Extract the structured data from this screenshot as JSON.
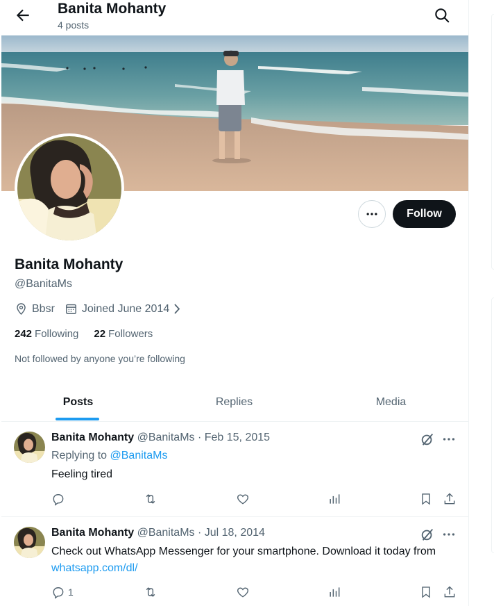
{
  "header": {
    "name": "Banita Mohanty",
    "posts_count": "4 posts"
  },
  "profile": {
    "name": "Banita Mohanty",
    "handle": "@BanitaMs",
    "location": "Bbsr",
    "joined": "Joined June 2014",
    "following_count": "242",
    "following_label": "Following",
    "followers_count": "22",
    "followers_label": "Followers",
    "not_followed_text": "Not followed by anyone you’re following",
    "follow_label": "Follow"
  },
  "tabs": [
    {
      "label": "Posts",
      "active": true
    },
    {
      "label": "Replies",
      "active": false
    },
    {
      "label": "Media",
      "active": false
    }
  ],
  "posts": [
    {
      "name": "Banita Mohanty",
      "meta": "@BanitaMs · Feb 15, 2015",
      "replying_prefix": "Replying to",
      "replying_handle": "@BanitaMs",
      "text": "Feeling tired",
      "reply_count": ""
    },
    {
      "name": "Banita Mohanty",
      "meta": "@BanitaMs · Jul 18, 2014",
      "text": "Check out WhatsApp Messenger for your smartphone. Download it today from",
      "link": "whatsapp.com/dl/",
      "reply_count": "1"
    }
  ],
  "icons": {
    "back": "back-arrow-icon",
    "search": "search-icon",
    "more": "more-horizontal-icon",
    "location": "location-pin-icon",
    "calendar": "calendar-icon",
    "chevron": "chevron-right-icon",
    "grok": "grok-icon",
    "reply": "reply-icon",
    "retweet": "retweet-icon",
    "like": "like-icon",
    "views": "views-icon",
    "bookmark": "bookmark-icon",
    "share": "share-icon"
  },
  "colors": {
    "accent": "#1d9bf0",
    "text": "#0f1419",
    "secondary": "#536471",
    "follow_bg": "#0f1419"
  }
}
